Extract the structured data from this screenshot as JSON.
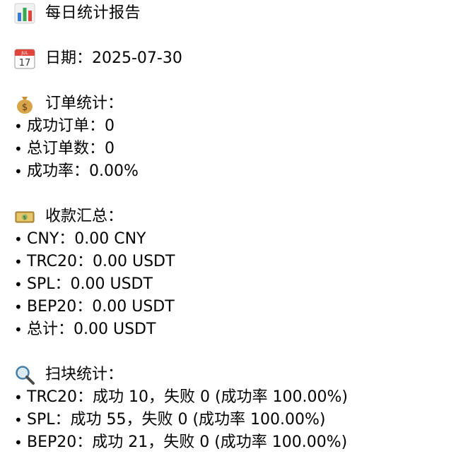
{
  "report": {
    "title": "每日统计报告",
    "date_line": "日期：2025-07-30",
    "orders": {
      "heading": "订单统计：",
      "items": [
        "成功订单：0",
        "总订单数：0",
        "成功率：0.00%"
      ]
    },
    "payments": {
      "heading": "收款汇总：",
      "items": [
        "CNY：0.00 CNY",
        "TRC20：0.00 USDT",
        "SPL：0.00 USDT",
        "BEP20：0.00 USDT",
        "总计：0.00 USDT"
      ]
    },
    "scan": {
      "heading": "扫块统计：",
      "items": [
        "TRC20：成功 10，失败 0 (成功率 100.00%)",
        "SPL：成功 55，失败 0 (成功率 100.00%)",
        "BEP20：成功 21，失败 0 (成功率 100.00%)"
      ]
    },
    "bullet": "•"
  },
  "icons": {
    "title": "bar-chart-icon",
    "date": "calendar-icon",
    "orders": "money-bag-icon",
    "payments": "banknotes-icon",
    "scan": "magnifying-glass-icon"
  }
}
